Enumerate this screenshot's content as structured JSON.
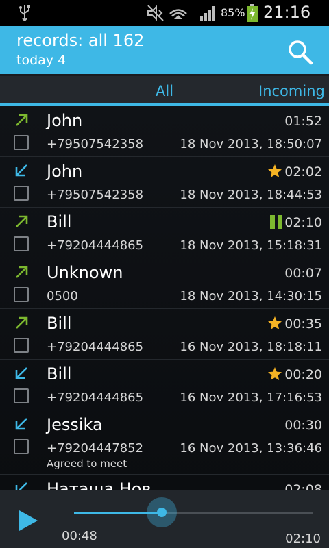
{
  "status_bar": {
    "battery_percent": "85%",
    "time": "21:16"
  },
  "header": {
    "title": "records: all 162",
    "subtitle": "today 4"
  },
  "tabs": [
    {
      "label": "All",
      "selected": true
    },
    {
      "label": "Incoming",
      "selected": false
    }
  ],
  "colors": {
    "accent": "#3eb8e6",
    "outgoing_arrow": "#7cb82f",
    "incoming_arrow": "#3eb8e6",
    "star": "#f5b324",
    "pause": "#7cb82f"
  },
  "records": [
    {
      "direction": "outgoing",
      "name": "John",
      "number": "+79507542358",
      "datetime": "18 Nov 2013, 18:50:07",
      "duration": "01:52",
      "badge": "none",
      "note": ""
    },
    {
      "direction": "incoming",
      "name": "John",
      "number": "+79507542358",
      "datetime": "18 Nov 2013, 18:44:53",
      "duration": "02:02",
      "badge": "star-icon",
      "note": ""
    },
    {
      "direction": "outgoing",
      "name": "Bill",
      "number": "+79204444865",
      "datetime": "18 Nov 2013, 15:18:31",
      "duration": "02:10",
      "badge": "pause-icon",
      "note": ""
    },
    {
      "direction": "outgoing",
      "name": "Unknown",
      "number": "0500",
      "datetime": "18 Nov 2013, 14:30:15",
      "duration": "00:07",
      "badge": "none",
      "note": ""
    },
    {
      "direction": "outgoing",
      "name": "Bill",
      "number": "+79204444865",
      "datetime": "16 Nov 2013, 18:18:11",
      "duration": "00:35",
      "badge": "star-icon",
      "note": ""
    },
    {
      "direction": "incoming",
      "name": "Bill",
      "number": "+79204444865",
      "datetime": "16 Nov 2013, 17:16:53",
      "duration": "00:20",
      "badge": "star-icon",
      "note": ""
    },
    {
      "direction": "incoming",
      "name": "Jessika",
      "number": "+79204447852",
      "datetime": "16 Nov 2013, 13:36:46",
      "duration": "00:30",
      "badge": "none",
      "note": "Agreed to meet"
    },
    {
      "direction": "incoming",
      "name": "Наташа Нов",
      "number": "",
      "datetime": "",
      "duration": "02:08",
      "badge": "none",
      "note": ""
    }
  ],
  "player": {
    "elapsed": "00:48",
    "total": "02:10",
    "progress": 0.369
  }
}
